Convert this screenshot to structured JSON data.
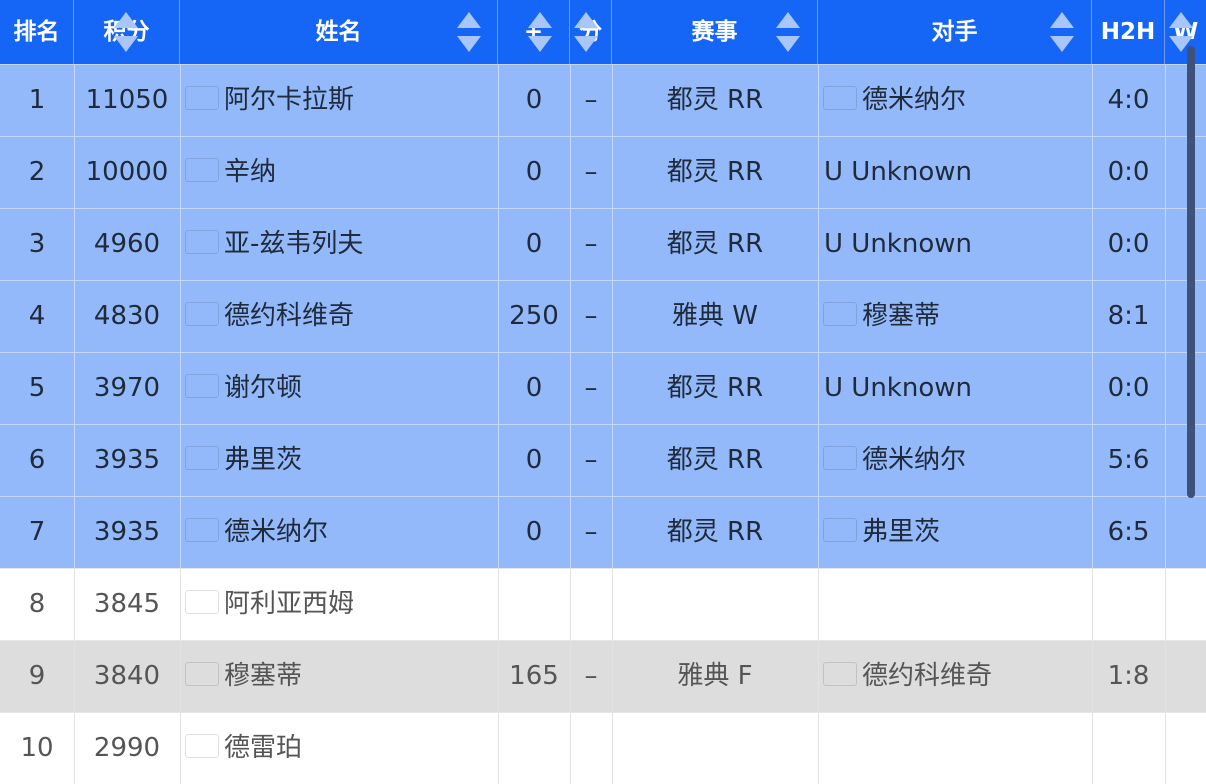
{
  "header": {
    "rank": "排名",
    "points": "积分",
    "name": "姓名",
    "plus": "+",
    "score": "分",
    "event": "赛事",
    "opponent": "对手",
    "h2h": "H2H",
    "w": "W"
  },
  "rows": [
    {
      "rank": "1",
      "points": "11050",
      "flag": "spain-flag-icon",
      "name": "阿尔卡拉斯",
      "plus": "0",
      "score": "–",
      "event": "都灵 RR",
      "opp_flag": "australia-flag-icon",
      "opponent": "德米纳尔",
      "h2h": "4:0",
      "style": "hl"
    },
    {
      "rank": "2",
      "points": "10000",
      "flag": "italy-flag-icon",
      "name": "辛纳",
      "plus": "0",
      "score": "–",
      "event": "都灵 RR",
      "opp_flag": "",
      "opponent": "U Unknown",
      "h2h": "0:0",
      "style": "hl"
    },
    {
      "rank": "3",
      "points": "4960",
      "flag": "germany-flag-icon",
      "name": "亚-兹韦列夫",
      "plus": "0",
      "score": "–",
      "event": "都灵 RR",
      "opp_flag": "",
      "opponent": "U Unknown",
      "h2h": "0:0",
      "style": "hl"
    },
    {
      "rank": "4",
      "points": "4830",
      "flag": "serbia-flag-icon",
      "name": "德约科维奇",
      "plus": "250",
      "score": "–",
      "event": "雅典 W",
      "opp_flag": "italy-flag-icon",
      "opponent": "穆塞蒂",
      "h2h": "8:1",
      "style": "hl"
    },
    {
      "rank": "5",
      "points": "3970",
      "flag": "usa-flag-icon",
      "name": "谢尔顿",
      "plus": "0",
      "score": "–",
      "event": "都灵 RR",
      "opp_flag": "",
      "opponent": "U Unknown",
      "h2h": "0:0",
      "style": "hl"
    },
    {
      "rank": "6",
      "points": "3935",
      "flag": "usa-flag-icon",
      "name": "弗里茨",
      "plus": "0",
      "score": "–",
      "event": "都灵 RR",
      "opp_flag": "australia-flag-icon",
      "opponent": "德米纳尔",
      "h2h": "5:6",
      "style": "hl"
    },
    {
      "rank": "7",
      "points": "3935",
      "flag": "australia-flag-icon",
      "name": "德米纳尔",
      "plus": "0",
      "score": "–",
      "event": "都灵 RR",
      "opp_flag": "usa-flag-icon",
      "opponent": "弗里茨",
      "h2h": "6:5",
      "style": "hl"
    },
    {
      "rank": "8",
      "points": "3845",
      "flag": "canada-flag-icon",
      "name": "阿利亚西姆",
      "plus": "",
      "score": "",
      "event": "",
      "opp_flag": "",
      "opponent": "",
      "h2h": "",
      "style": "white"
    },
    {
      "rank": "9",
      "points": "3840",
      "flag": "italy-flag-icon",
      "name": "穆塞蒂",
      "plus": "165",
      "score": "–",
      "event": "雅典 F",
      "opp_flag": "serbia-flag-icon",
      "opponent": "德约科维奇",
      "h2h": "1:8",
      "style": "gray"
    },
    {
      "rank": "10",
      "points": "2990",
      "flag": "uk-flag-icon",
      "name": "德雷珀",
      "plus": "",
      "score": "",
      "event": "",
      "opp_flag": "",
      "opponent": "",
      "h2h": "",
      "style": "white"
    }
  ]
}
